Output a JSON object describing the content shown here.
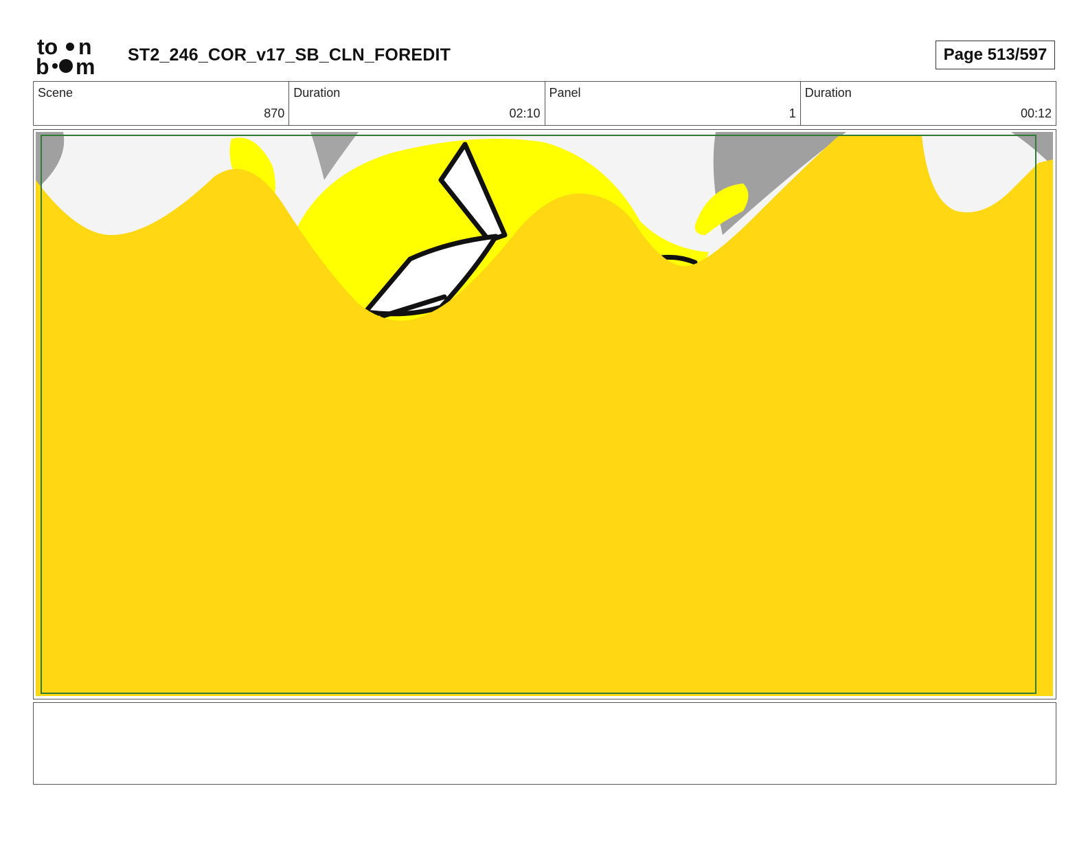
{
  "header": {
    "logo_top": "to",
    "logo_top_end": "n",
    "logo_bottom_start": "b",
    "logo_bottom_end": "m",
    "title": "ST2_246_COR_v17_SB_CLN_FOREDIT",
    "page_label": "Page 513/597"
  },
  "info": {
    "scene_label": "Scene",
    "scene_value": "870",
    "scene_duration_label": "Duration",
    "scene_duration_value": "02:10",
    "panel_label": "Panel",
    "panel_value": "1",
    "panel_duration_label": "Duration",
    "panel_duration_value": "00:12"
  },
  "colors": {
    "foreground_yellow": "#FFD713",
    "bright_yellow": "#FFFF00",
    "safe_frame": "#2E7D32",
    "gray_shape": "#A0A0A0",
    "light_bg": "#F4F4F4"
  },
  "caption": ""
}
